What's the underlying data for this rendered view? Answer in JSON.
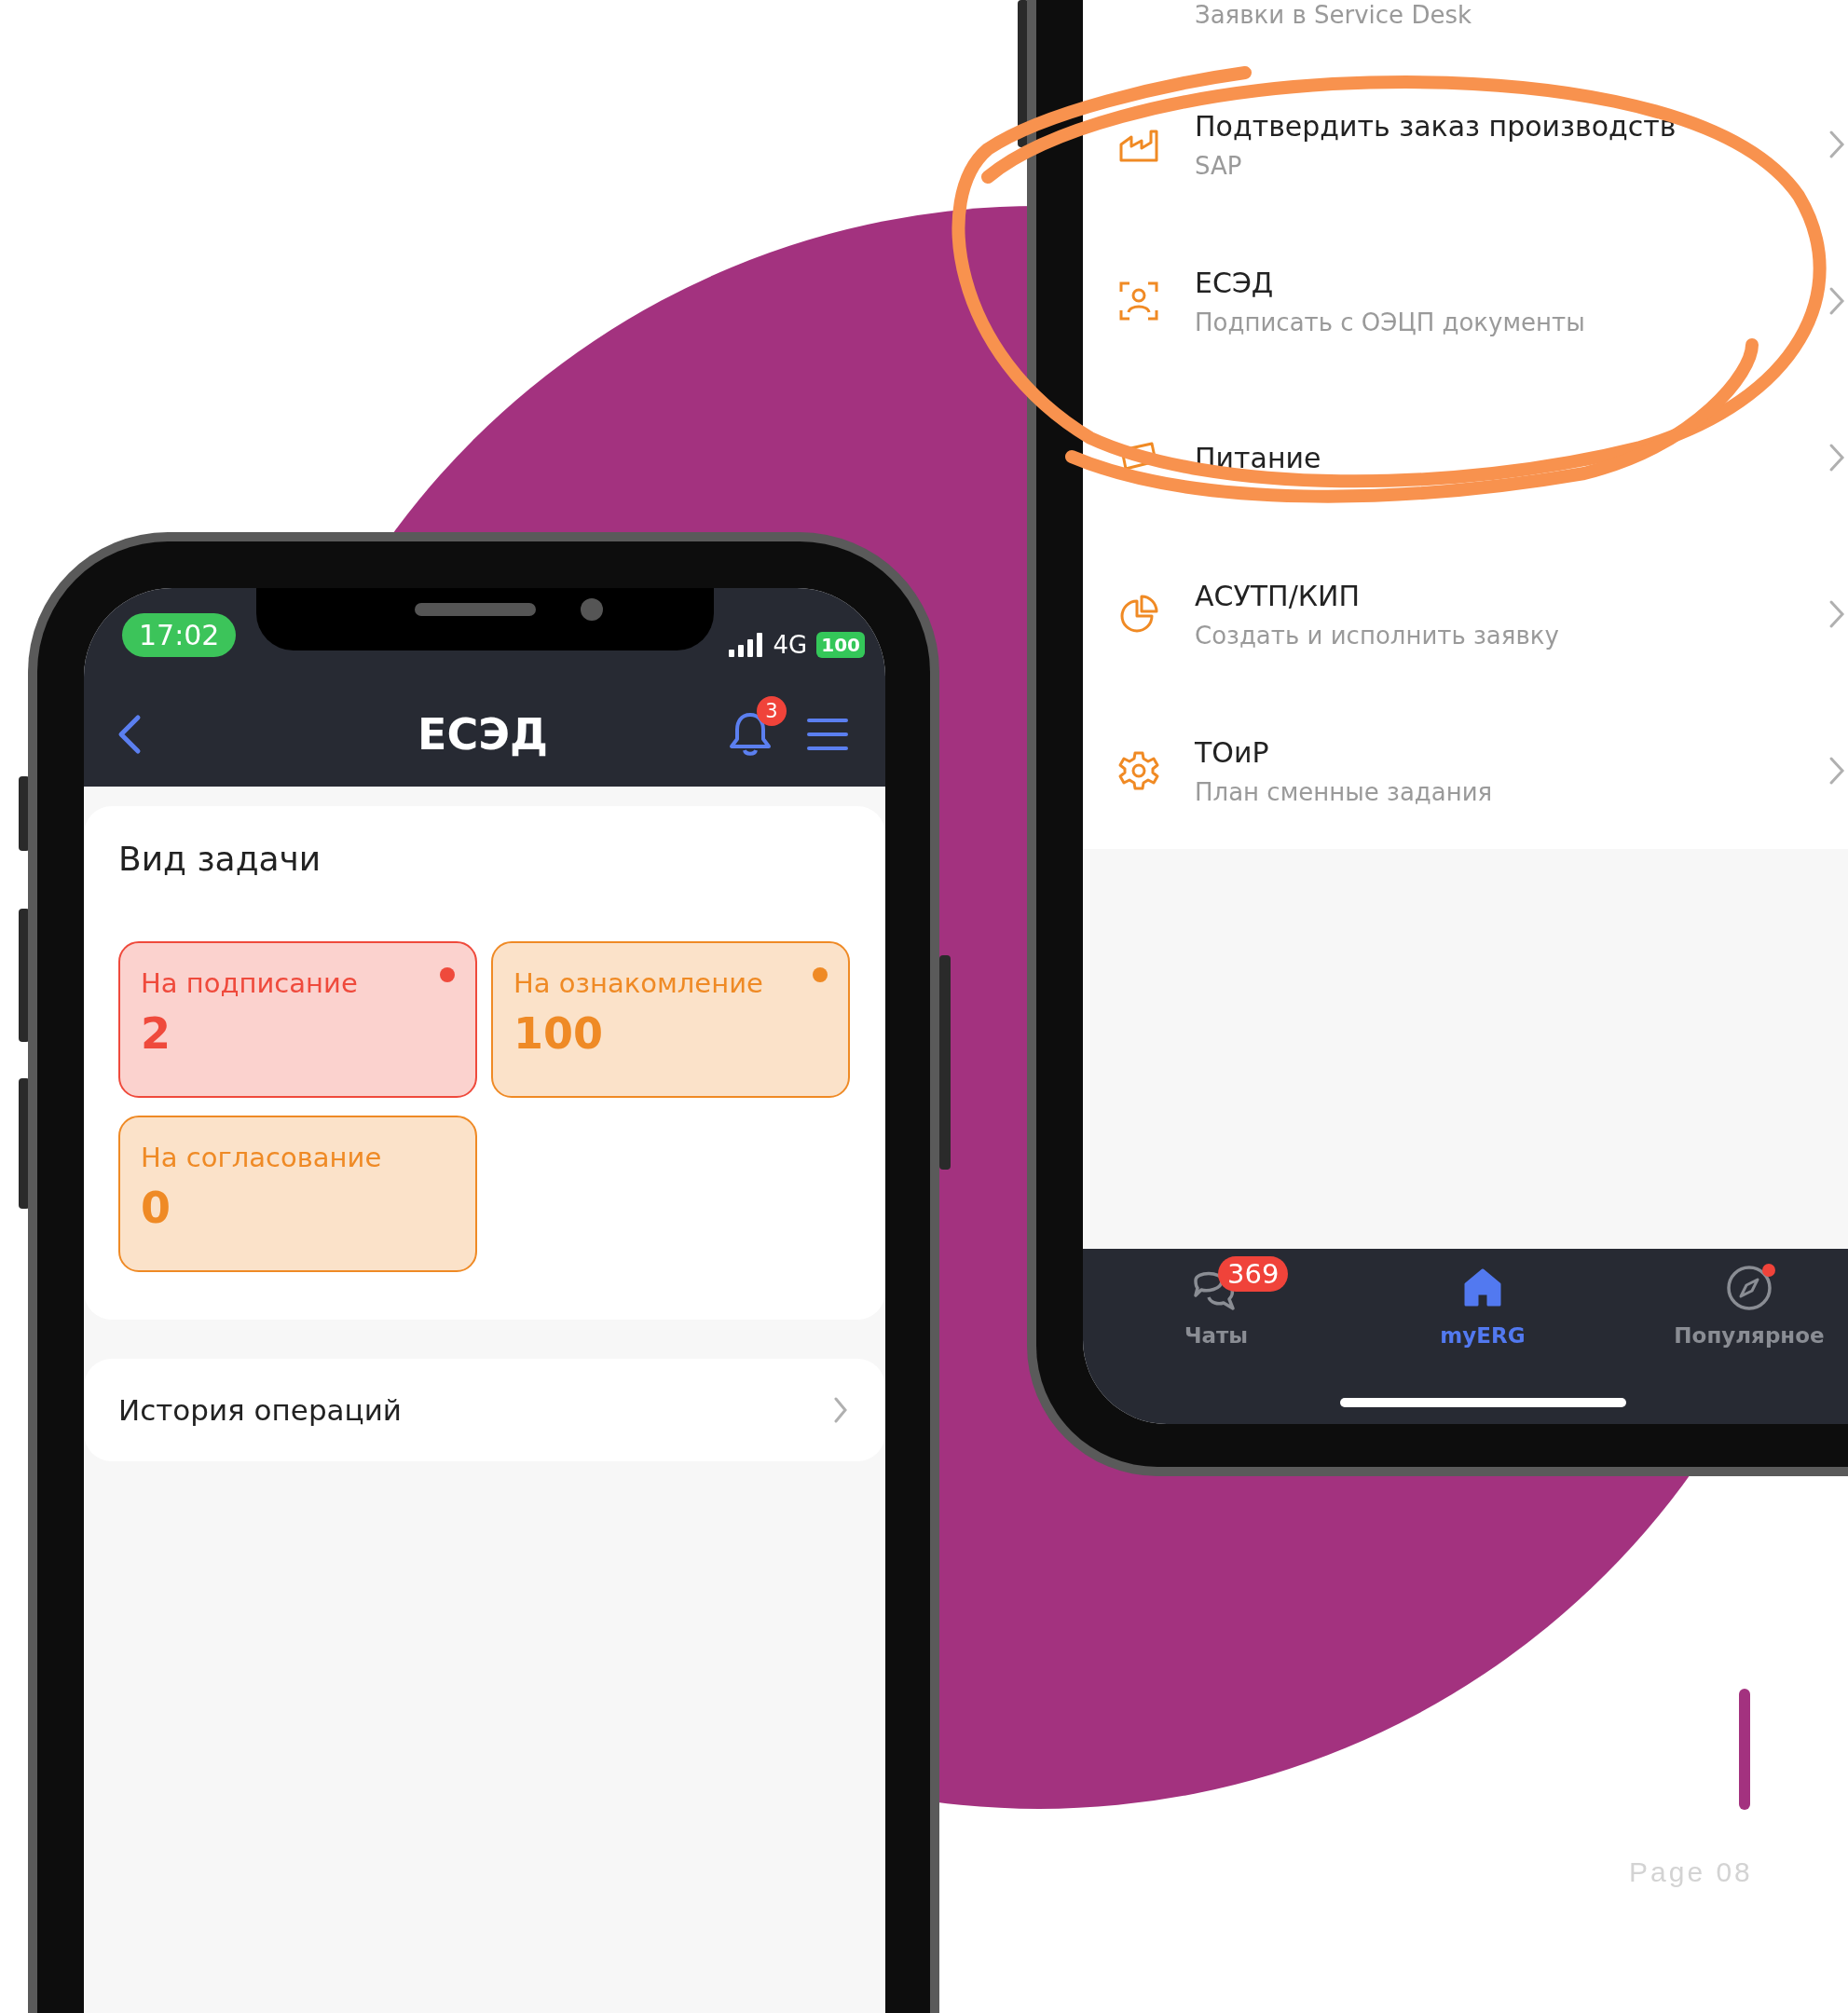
{
  "left_phone": {
    "status_bar": {
      "time": "17:02",
      "network": "4G",
      "battery": "100"
    },
    "header": {
      "title": "ЕСЭД",
      "notification_count": "3"
    },
    "task_section": {
      "title": "Вид задачи",
      "tiles": [
        {
          "label": "На подписание",
          "count": "2",
          "color": "#ef4a3c",
          "has_dot": true
        },
        {
          "label": "На ознакомление",
          "count": "100",
          "color": "#ef8a25",
          "has_dot": true
        },
        {
          "label": "На согласование",
          "count": "0",
          "color": "#ef8a25",
          "has_dot": false
        }
      ]
    },
    "history_link": "История операций"
  },
  "right_phone": {
    "services": [
      {
        "subtitle": "Заявки в Service Desk"
      },
      {
        "title": "Подтвердить заказ производств",
        "subtitle": "SAP"
      },
      {
        "title": "ЕСЭД",
        "subtitle": "Подписать с ОЭЦП документы"
      },
      {
        "title": "Питание"
      },
      {
        "title": "АСУТП/КИП",
        "subtitle": "Создать и исполнить заявку"
      },
      {
        "title": "ТОиР",
        "subtitle": "План сменные задания"
      }
    ],
    "nav": [
      {
        "label": "Чаты",
        "badge": "369",
        "selected": false,
        "has_dot": false
      },
      {
        "label": "myERG",
        "selected": true,
        "has_dot": false
      },
      {
        "label": "Популярное",
        "selected": false,
        "has_dot": true
      }
    ]
  },
  "slide": {
    "page_label": "Page 08"
  }
}
